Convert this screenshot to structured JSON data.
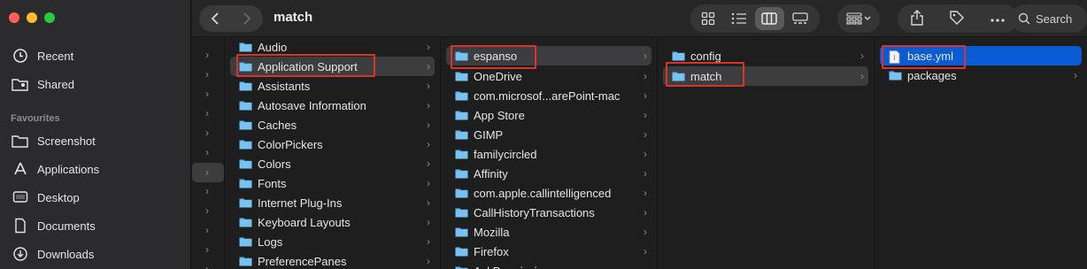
{
  "window": {
    "title": "match"
  },
  "sidebar": {
    "top_items": [
      {
        "label": "Recent",
        "icon": "clock-icon"
      },
      {
        "label": "Shared",
        "icon": "shared-folder-icon"
      }
    ],
    "favourites_heading": "Favourites",
    "favourites": [
      {
        "label": "Screenshot",
        "icon": "folder-icon"
      },
      {
        "label": "Applications",
        "icon": "applications-icon"
      },
      {
        "label": "Desktop",
        "icon": "desktop-icon"
      },
      {
        "label": "Documents",
        "icon": "document-icon"
      },
      {
        "label": "Downloads",
        "icon": "download-icon"
      }
    ]
  },
  "toolbar": {
    "search_label": "Search"
  },
  "columns": {
    "col1": [
      "Audio",
      "Application Support",
      "Assistants",
      "Autosave Information",
      "Caches",
      "ColorPickers",
      "Colors",
      "Fonts",
      "Internet Plug-Ins",
      "Keyboard Layouts",
      "Logs",
      "PreferencePanes"
    ],
    "col2": [
      "espanso",
      "OneDrive",
      "com.microsof...arePoint-mac",
      "App Store",
      "GIMP",
      "familycircled",
      "Affinity",
      "com.apple.callintelligenced",
      "CallHistoryTransactions",
      "Mozilla",
      "Firefox",
      "AskPermission"
    ],
    "col3": [
      "config",
      "match"
    ],
    "col4": [
      "base.yml",
      "packages"
    ]
  },
  "colors": {
    "selection_blue": "#0a5bd4",
    "highlight_red": "#d9332b"
  }
}
